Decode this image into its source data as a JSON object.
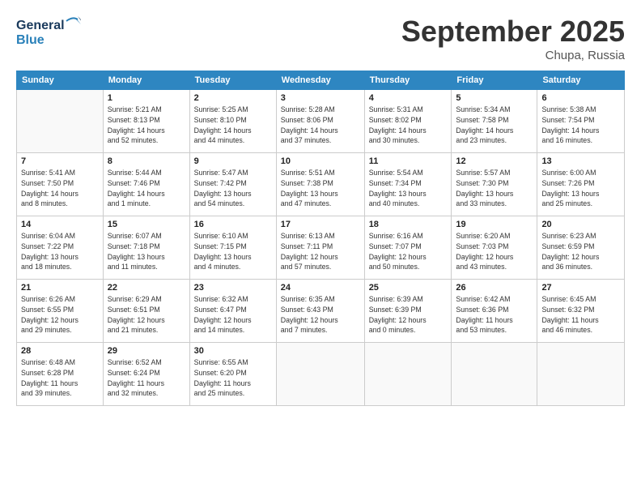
{
  "header": {
    "logo_general": "General",
    "logo_blue": "Blue",
    "month_title": "September 2025",
    "location": "Chupa, Russia"
  },
  "weekdays": [
    "Sunday",
    "Monday",
    "Tuesday",
    "Wednesday",
    "Thursday",
    "Friday",
    "Saturday"
  ],
  "weeks": [
    [
      {
        "day": "",
        "info": ""
      },
      {
        "day": "1",
        "info": "Sunrise: 5:21 AM\nSunset: 8:13 PM\nDaylight: 14 hours\nand 52 minutes."
      },
      {
        "day": "2",
        "info": "Sunrise: 5:25 AM\nSunset: 8:10 PM\nDaylight: 14 hours\nand 44 minutes."
      },
      {
        "day": "3",
        "info": "Sunrise: 5:28 AM\nSunset: 8:06 PM\nDaylight: 14 hours\nand 37 minutes."
      },
      {
        "day": "4",
        "info": "Sunrise: 5:31 AM\nSunset: 8:02 PM\nDaylight: 14 hours\nand 30 minutes."
      },
      {
        "day": "5",
        "info": "Sunrise: 5:34 AM\nSunset: 7:58 PM\nDaylight: 14 hours\nand 23 minutes."
      },
      {
        "day": "6",
        "info": "Sunrise: 5:38 AM\nSunset: 7:54 PM\nDaylight: 14 hours\nand 16 minutes."
      }
    ],
    [
      {
        "day": "7",
        "info": "Sunrise: 5:41 AM\nSunset: 7:50 PM\nDaylight: 14 hours\nand 8 minutes."
      },
      {
        "day": "8",
        "info": "Sunrise: 5:44 AM\nSunset: 7:46 PM\nDaylight: 14 hours\nand 1 minute."
      },
      {
        "day": "9",
        "info": "Sunrise: 5:47 AM\nSunset: 7:42 PM\nDaylight: 13 hours\nand 54 minutes."
      },
      {
        "day": "10",
        "info": "Sunrise: 5:51 AM\nSunset: 7:38 PM\nDaylight: 13 hours\nand 47 minutes."
      },
      {
        "day": "11",
        "info": "Sunrise: 5:54 AM\nSunset: 7:34 PM\nDaylight: 13 hours\nand 40 minutes."
      },
      {
        "day": "12",
        "info": "Sunrise: 5:57 AM\nSunset: 7:30 PM\nDaylight: 13 hours\nand 33 minutes."
      },
      {
        "day": "13",
        "info": "Sunrise: 6:00 AM\nSunset: 7:26 PM\nDaylight: 13 hours\nand 25 minutes."
      }
    ],
    [
      {
        "day": "14",
        "info": "Sunrise: 6:04 AM\nSunset: 7:22 PM\nDaylight: 13 hours\nand 18 minutes."
      },
      {
        "day": "15",
        "info": "Sunrise: 6:07 AM\nSunset: 7:18 PM\nDaylight: 13 hours\nand 11 minutes."
      },
      {
        "day": "16",
        "info": "Sunrise: 6:10 AM\nSunset: 7:15 PM\nDaylight: 13 hours\nand 4 minutes."
      },
      {
        "day": "17",
        "info": "Sunrise: 6:13 AM\nSunset: 7:11 PM\nDaylight: 12 hours\nand 57 minutes."
      },
      {
        "day": "18",
        "info": "Sunrise: 6:16 AM\nSunset: 7:07 PM\nDaylight: 12 hours\nand 50 minutes."
      },
      {
        "day": "19",
        "info": "Sunrise: 6:20 AM\nSunset: 7:03 PM\nDaylight: 12 hours\nand 43 minutes."
      },
      {
        "day": "20",
        "info": "Sunrise: 6:23 AM\nSunset: 6:59 PM\nDaylight: 12 hours\nand 36 minutes."
      }
    ],
    [
      {
        "day": "21",
        "info": "Sunrise: 6:26 AM\nSunset: 6:55 PM\nDaylight: 12 hours\nand 29 minutes."
      },
      {
        "day": "22",
        "info": "Sunrise: 6:29 AM\nSunset: 6:51 PM\nDaylight: 12 hours\nand 21 minutes."
      },
      {
        "day": "23",
        "info": "Sunrise: 6:32 AM\nSunset: 6:47 PM\nDaylight: 12 hours\nand 14 minutes."
      },
      {
        "day": "24",
        "info": "Sunrise: 6:35 AM\nSunset: 6:43 PM\nDaylight: 12 hours\nand 7 minutes."
      },
      {
        "day": "25",
        "info": "Sunrise: 6:39 AM\nSunset: 6:39 PM\nDaylight: 12 hours\nand 0 minutes."
      },
      {
        "day": "26",
        "info": "Sunrise: 6:42 AM\nSunset: 6:36 PM\nDaylight: 11 hours\nand 53 minutes."
      },
      {
        "day": "27",
        "info": "Sunrise: 6:45 AM\nSunset: 6:32 PM\nDaylight: 11 hours\nand 46 minutes."
      }
    ],
    [
      {
        "day": "28",
        "info": "Sunrise: 6:48 AM\nSunset: 6:28 PM\nDaylight: 11 hours\nand 39 minutes."
      },
      {
        "day": "29",
        "info": "Sunrise: 6:52 AM\nSunset: 6:24 PM\nDaylight: 11 hours\nand 32 minutes."
      },
      {
        "day": "30",
        "info": "Sunrise: 6:55 AM\nSunset: 6:20 PM\nDaylight: 11 hours\nand 25 minutes."
      },
      {
        "day": "",
        "info": ""
      },
      {
        "day": "",
        "info": ""
      },
      {
        "day": "",
        "info": ""
      },
      {
        "day": "",
        "info": ""
      }
    ]
  ]
}
